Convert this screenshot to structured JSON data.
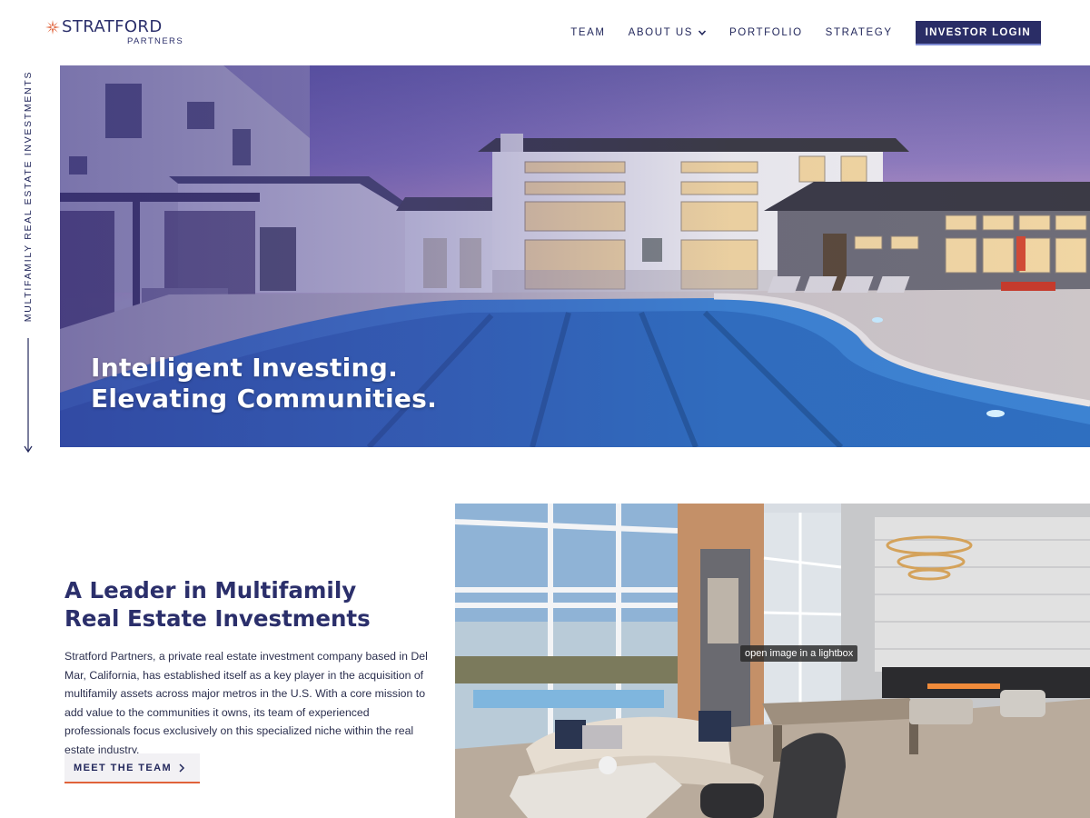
{
  "brand": {
    "name": "STRATFORD",
    "sub": "PARTNERS",
    "accent_color": "#e0623a",
    "navy_color": "#2a2d66"
  },
  "nav": {
    "items": [
      {
        "label": "TEAM"
      },
      {
        "label": "ABOUT US",
        "icon": "chevron-down-icon"
      },
      {
        "label": "PORTFOLIO"
      },
      {
        "label": "STRATEGY"
      }
    ],
    "login_label": "INVESTOR LOGIN"
  },
  "side_label": "MULTIFAMILY REAL ESTATE INVESTMENTS",
  "hero": {
    "line1": "Intelligent Investing.",
    "line2": "Elevating Communities."
  },
  "about": {
    "title_line1": "A Leader in Multifamily",
    "title_line2": "Real Estate Investments",
    "body": "Stratford Partners, a private real estate investment company based in Del Mar, California, has established itself as a key player in the acquisition of multifamily assets across major metros in the U.S. With a core mission to add value to the communities it owns, its team of experienced professionals focus exclusively on this specialized niche within the real estate industry.",
    "button_label": "MEET THE TEAM"
  },
  "lightbox_tooltip": "open image in a lightbox"
}
